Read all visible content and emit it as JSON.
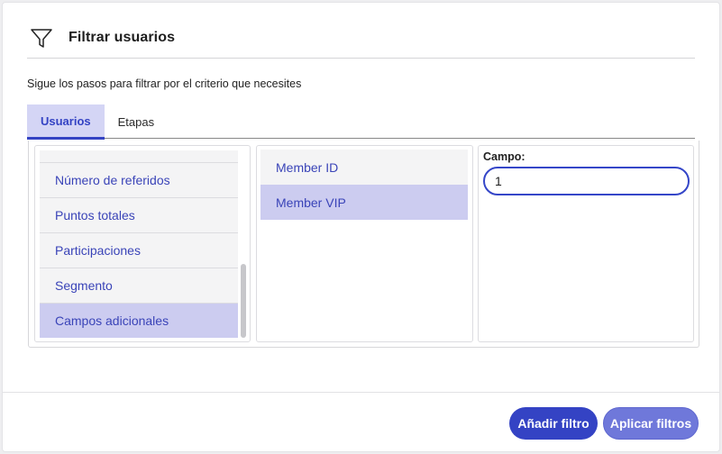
{
  "dialog": {
    "title": "Filtrar usuarios",
    "icon": "filter-icon",
    "subtitle": "Sigue los pasos para filtrar por el criterio que necesites"
  },
  "tabs": [
    {
      "label": "Usuarios",
      "active": true
    },
    {
      "label": "Etapas",
      "active": false
    }
  ],
  "criteria_list": {
    "items": [
      {
        "label": ""
      },
      {
        "label": "Número de referidos"
      },
      {
        "label": "Puntos totales"
      },
      {
        "label": "Participaciones"
      },
      {
        "label": "Segmento"
      },
      {
        "label": "Campos adicionales",
        "selected": true
      }
    ]
  },
  "fields_list": {
    "items": [
      {
        "label": "Member ID"
      },
      {
        "label": "Member VIP",
        "selected": true
      }
    ]
  },
  "value_panel": {
    "label": "Campo:",
    "input_value": "1"
  },
  "footer": {
    "add_button": "Añadir filtro",
    "apply_button": "Aplicar filtros"
  },
  "colors": {
    "accent": "#3443c4",
    "selected_bg": "#ccccf0",
    "tab_active_bg": "#d4d5f5"
  }
}
